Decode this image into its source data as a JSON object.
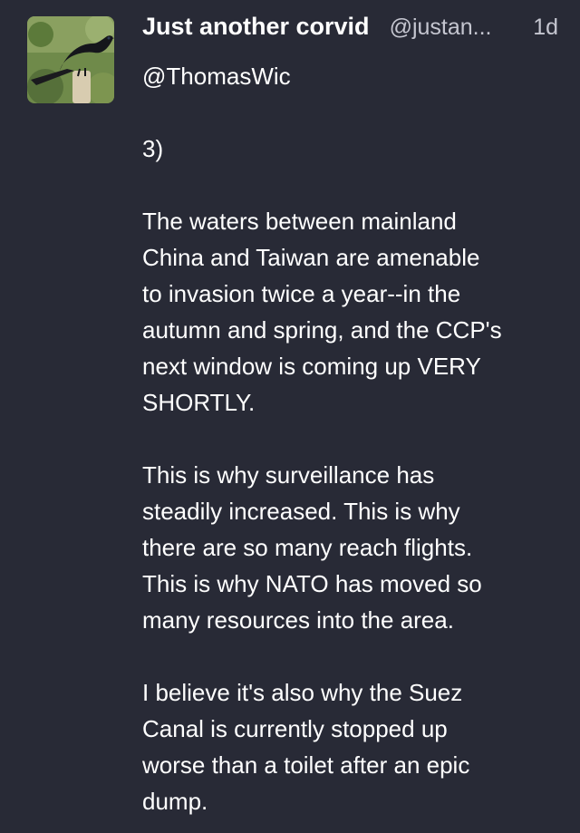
{
  "post": {
    "author": {
      "display_name": "Just another corvid",
      "handle": "@justan...",
      "avatar_icon": "crow-avatar-icon"
    },
    "timestamp": "1d",
    "mention": "@ThomasWic",
    "paragraphs": [
      "3)",
      "The waters between mainland\nChina and Taiwan are amenable\nto invasion twice a year--in the\nautumn and spring, and the CCP's\nnext window is coming up VERY\nSHORTLY.",
      "This is why surveillance has\nsteadily increased.  This is why\nthere are so many reach flights.\nThis is why NATO has moved so\nmany resources into the area.",
      "I believe it's also why the Suez\nCanal is currently stopped up\nworse than a toilet after an epic\ndump."
    ]
  },
  "colors": {
    "background": "#282a36",
    "text": "#ffffff",
    "muted": "#c5c6d0"
  }
}
